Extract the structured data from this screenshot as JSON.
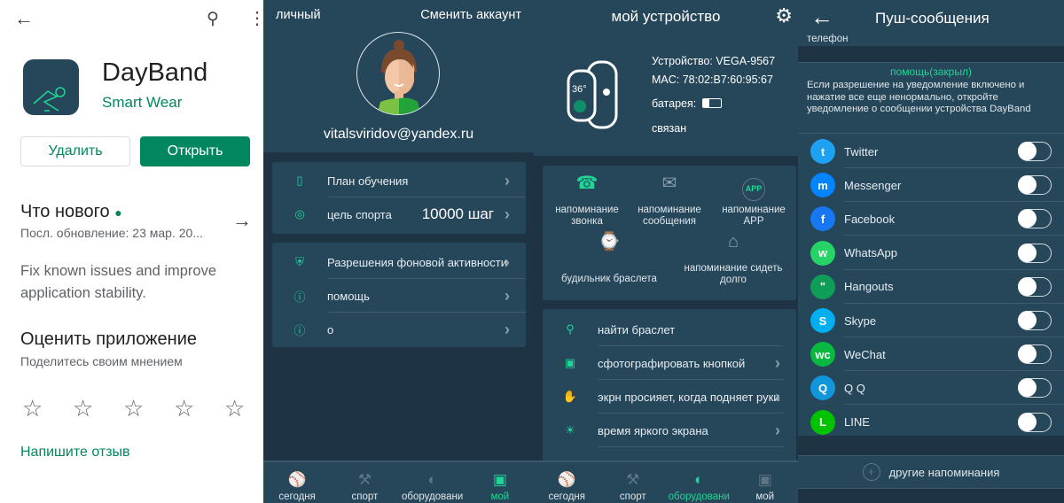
{
  "play_store": {
    "app_name": "DayBand",
    "developer": "Smart Wear",
    "uninstall_label": "Удалить",
    "open_label": "Открыть",
    "whats_new_title": "Что нового",
    "last_update": "Посл. обновление: 23 мар. 20...",
    "whats_new_text": "Fix known issues and improve application stability.",
    "rate_title": "Оценить приложение",
    "rate_subtitle": "Поделитесь своим мнением",
    "rating_stars": 5,
    "write_review": "Напишите отзыв",
    "accent": "#01875f"
  },
  "profile": {
    "tab_label": "личный",
    "switch_account": "Сменить аккаунт",
    "email": "vitalsviridov@yandex.ru",
    "group1": [
      {
        "label": "План обучения",
        "icon": "document-icon"
      },
      {
        "label": "цель спорта",
        "value": "10000 шаг",
        "icon": "target-icon"
      }
    ],
    "group2": [
      {
        "label": "Разрешения фоновой активности",
        "icon": "shield-key-icon"
      },
      {
        "label": "помощь",
        "icon": "help-icon"
      },
      {
        "label": "о",
        "icon": "info-icon"
      }
    ]
  },
  "device": {
    "title": "мой устройство",
    "device_line": "Устройство: VEGA-9567",
    "mac_line": "MAC: 78:02:B7:60:95:67",
    "battery_label": "батарея:",
    "status": "связан",
    "band_temp": "36°",
    "tiles": [
      {
        "label": "напоминание звонка",
        "icon": "phone-icon"
      },
      {
        "label": "напоминание сообщения",
        "icon": "envelope-icon"
      },
      {
        "label": "напоминание APP",
        "icon": "app-icon",
        "icon_text": "APP"
      },
      {
        "label": "будильник браслета",
        "icon": "band-alarm-icon"
      },
      {
        "label": "напоминание сидеть долго",
        "icon": "chair-icon"
      }
    ],
    "list": [
      {
        "label": "найти браслет",
        "icon": "search-icon"
      },
      {
        "label": "сфотографировать кнопкой",
        "icon": "camera-icon"
      },
      {
        "label": "экрн просияет, когда подняет руки",
        "icon": "wrist-raise-icon"
      },
      {
        "label": "время яркого экрана",
        "icon": "brightness-icon"
      }
    ]
  },
  "nav_left": [
    {
      "label": "сегодня",
      "icon": "ball-icon"
    },
    {
      "label": "спорт",
      "icon": "dumbbell-icon"
    },
    {
      "label": "оборудовани",
      "icon": "helmet-icon"
    },
    {
      "label": "мой",
      "icon": "jersey-icon",
      "active": true
    }
  ],
  "nav_right": [
    {
      "label": "сегодня",
      "icon": "ball-icon"
    },
    {
      "label": "спорт",
      "icon": "dumbbell-icon"
    },
    {
      "label": "оборудовани",
      "icon": "helmet-icon",
      "active": true
    },
    {
      "label": "мой",
      "icon": "jersey-icon"
    }
  ],
  "push": {
    "title": "Пуш-сообщения",
    "cut_text": "телефон",
    "help_title": "помощь(закрыл)",
    "help_text": "Если разрешение на уведомление включено и нажатие все еще ненормально, откройте уведомление о сообщении устройства DayBand",
    "apps": [
      {
        "name": "Twitter",
        "color": "#1da1f2",
        "glyph": "t",
        "enabled": false
      },
      {
        "name": "Messenger",
        "color": "#0084ff",
        "glyph": "m",
        "enabled": false
      },
      {
        "name": "Facebook",
        "color": "#1877f2",
        "glyph": "f",
        "enabled": false
      },
      {
        "name": "WhatsApp",
        "color": "#25d366",
        "glyph": "w",
        "enabled": false
      },
      {
        "name": "Hangouts",
        "color": "#0f9d58",
        "glyph": "\"",
        "enabled": false
      },
      {
        "name": "Skype",
        "color": "#00aff0",
        "glyph": "S",
        "enabled": false
      },
      {
        "name": "WeChat",
        "color": "#09b83e",
        "glyph": "wc",
        "enabled": false
      },
      {
        "name": "Q Q",
        "color": "#1296db",
        "glyph": "Q",
        "enabled": false
      },
      {
        "name": "LINE",
        "color": "#00c300",
        "glyph": "L",
        "enabled": false
      }
    ],
    "other_reminders": "другие напоминания"
  },
  "colors": {
    "accent_green": "#1ed696",
    "panel_bg": "#26465a",
    "dark_bg": "#1e3343"
  }
}
